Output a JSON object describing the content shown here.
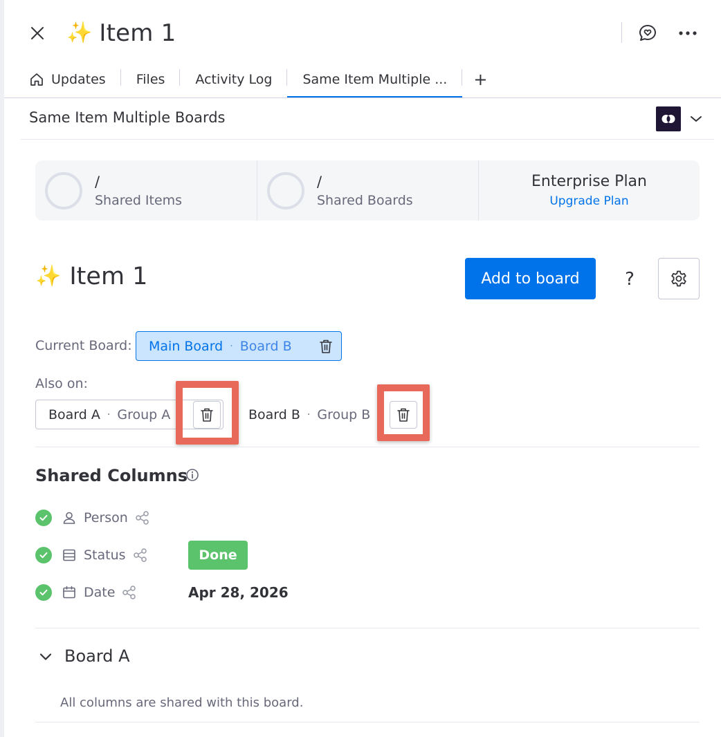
{
  "header": {
    "sparkle": "✨",
    "title": "Item 1"
  },
  "tabs": [
    {
      "label": "Updates"
    },
    {
      "label": "Files"
    },
    {
      "label": "Activity Log"
    },
    {
      "label": "Same Item Multiple ..."
    }
  ],
  "tab_add": "+",
  "app": {
    "title": "Same Item Multiple Boards"
  },
  "stats": {
    "shared_items": {
      "value": "/",
      "label": "Shared Items"
    },
    "shared_boards": {
      "value": "/",
      "label": "Shared Boards"
    },
    "plan": {
      "name": "Enterprise Plan",
      "link": "Upgrade Plan"
    }
  },
  "item": {
    "sparkle": "✨",
    "name": "Item 1",
    "add_button": "Add to board",
    "help": "?"
  },
  "current_board": {
    "label": "Current Board:",
    "board": "Main Board",
    "separator": "·",
    "group": "Board B"
  },
  "also_on": {
    "label": "Also on:",
    "chips": [
      {
        "board": "Board A",
        "separator": "·",
        "group": "Group A"
      },
      {
        "board": "Board B",
        "separator": "·",
        "group": "Group B"
      }
    ]
  },
  "shared_columns": {
    "title": "Shared Columns",
    "columns": [
      {
        "name": "Person",
        "value": ""
      },
      {
        "name": "Status",
        "value": "Done"
      },
      {
        "name": "Date",
        "value": "Apr 28, 2026"
      }
    ]
  },
  "board_section": {
    "title": "Board A",
    "note": "All columns are shared with this board."
  },
  "colors": {
    "accent": "#0073ea",
    "done": "#5bc36b",
    "highlight": "#e8685a",
    "logo_bg": "#1f1534"
  }
}
